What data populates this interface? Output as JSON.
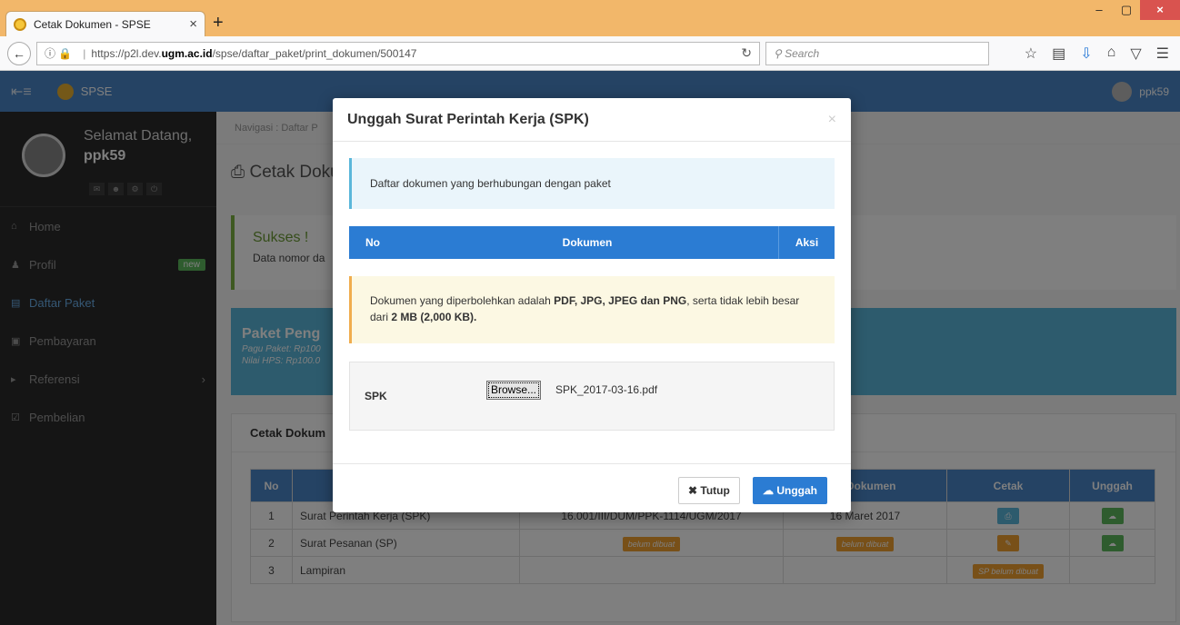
{
  "browser": {
    "tab_title": "Cetak Dokumen - SPSE",
    "tab_close": "×",
    "new_tab": "+",
    "url_prefix": "https://p2l.dev.",
    "url_domain": "ugm.ac.id",
    "url_path": "/spse/daftar_paket/print_dokumen/500147",
    "search_placeholder": "Search",
    "win_min": "–",
    "win_max": "▢",
    "win_close": "×"
  },
  "header": {
    "brand": "SPSE",
    "user": "ppk59"
  },
  "sidebar": {
    "welcome": "Selamat Datang,",
    "username": "ppk59",
    "items": [
      {
        "label": "Home",
        "icon": "home-icon"
      },
      {
        "label": "Profil",
        "icon": "user-icon",
        "badge": "new"
      },
      {
        "label": "Daftar Paket",
        "icon": "book-icon"
      },
      {
        "label": "Pembayaran",
        "icon": "money-icon"
      },
      {
        "label": "Referensi",
        "icon": "caret-icon"
      },
      {
        "label": "Pembelian",
        "icon": "cart-icon"
      }
    ]
  },
  "main": {
    "breadcrumb": "Navigasi :   Daftar P",
    "page_title": "Cetak Doku",
    "alert_title": "Sukses !",
    "alert_text": "Data nomor da",
    "paket_title": "Paket Peng",
    "paket_pagu": "Pagu Paket: Rp100",
    "paket_hps": "Nilai HPS: Rp100.0",
    "box_title": "Cetak Dokum",
    "table_headers": [
      "No",
      "",
      "",
      "al Dokumen",
      "Cetak",
      "Unggah"
    ],
    "rows": [
      {
        "no": "1",
        "doc": "Surat Perintah Kerja (SPK)",
        "nomor": "16.001/III/DUM/PPK-1114/UGM/2017",
        "tanggal": "16 Maret 2017"
      },
      {
        "no": "2",
        "doc": "Surat Pesanan (SP)",
        "nomor": "belum dibuat",
        "tanggal": "belum dibuat"
      },
      {
        "no": "3",
        "doc": "Lampiran",
        "cetak": "SP belum dibuat"
      }
    ]
  },
  "modal": {
    "title": "Unggah Surat Perintah Kerja (SPK)",
    "close": "×",
    "info": "Daftar dokumen yang berhubungan dengan paket",
    "col_no": "No",
    "col_dokumen": "Dokumen",
    "col_aksi": "Aksi",
    "warn_pre": "Dokumen yang diperbolehkan adalah ",
    "warn_types": "PDF, JPG, JPEG dan PNG",
    "warn_mid": ", serta tidak lebih besar dari ",
    "warn_size": "2 MB (2,000 KB).",
    "field_label": "SPK",
    "browse": "Browse...",
    "file_name": "SPK_2017-03-16.pdf",
    "btn_tutup": "Tutup",
    "btn_unggah": "Unggah"
  }
}
